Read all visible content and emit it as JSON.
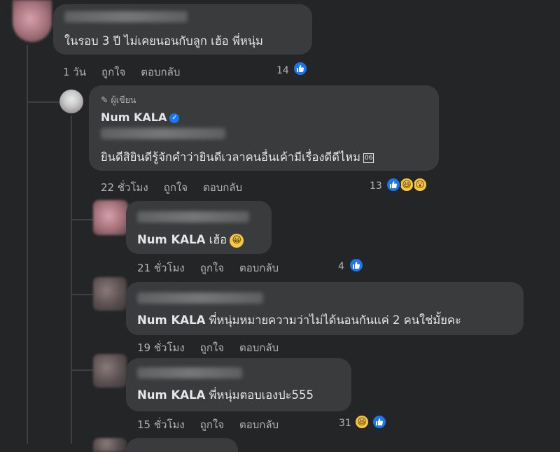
{
  "comments": [
    {
      "text": "ในรอบ 3 ปี ไม่เคยนอนกับลูก เฮ้อ พี่หนุ่ม",
      "time": "1 วัน",
      "like": "ถูกใจ",
      "reply": "ตอบกลับ",
      "reactions": "14"
    },
    {
      "badge": "ผู้เขียน",
      "author": "Num KALA",
      "text": "ยินดีสิยินดีรู้จักคำว่ายินดีเวลาคนอื่นเค้ามีเรื่องดีดีไหม",
      "box_glyph": "06",
      "time": "22 ชั่วโมง",
      "like": "ถูกใจ",
      "reply": "ตอบกลับ",
      "reactions": "13"
    },
    {
      "mention": "Num KALA",
      "text": " เฮ้อ",
      "time": "21 ชั่วโมง",
      "like": "ถูกใจ",
      "reply": "ตอบกลับ",
      "reactions": "4"
    },
    {
      "mention": "Num KALA",
      "text": " พี่หนุ่มหมายความว่าไม่ได้นอนกันแค่ 2 คนใช่มั้ยคะ",
      "time": "19 ชั่วโมง",
      "like": "ถูกใจ",
      "reply": "ตอบกลับ"
    },
    {
      "mention": "Num KALA",
      "text": " พี่หนุ่มตอบเองปะ555",
      "time": "15 ชั่วโมง",
      "like": "ถูกใจ",
      "reply": "ตอบกลับ",
      "reactions": "31"
    }
  ],
  "icons": {
    "like": "like-thumb-icon",
    "haha": "haha-emoji-icon",
    "wow": "wow-emoji-icon",
    "verified": "verified-badge-icon",
    "pencil": "pencil-icon",
    "smile": "grinning-emoji-icon"
  },
  "colors": {
    "like_blue": "#1877f2",
    "emoji_yellow": "#f7c940",
    "bubble": "#3a3b3c",
    "background": "#242526"
  }
}
